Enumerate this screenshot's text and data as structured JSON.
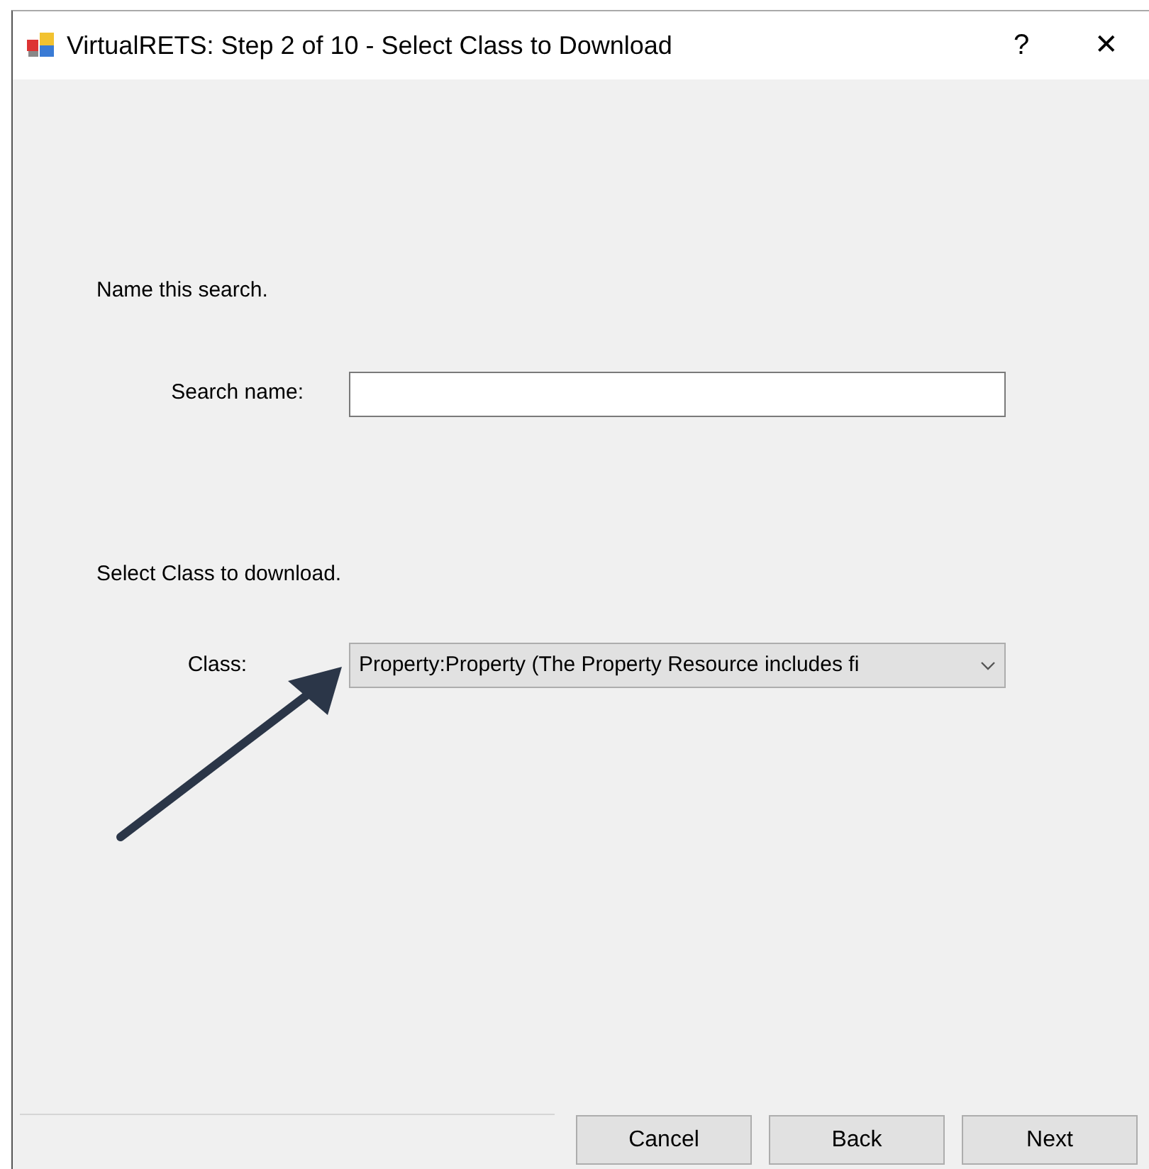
{
  "window": {
    "title": "VirtualRETS: Step 2 of 10 - Select Class to Download",
    "help": "?",
    "close": "✕"
  },
  "name_section": {
    "prompt": "Name this search.",
    "label": "Search name:"
  },
  "class_section": {
    "prompt": "Select Class to download.",
    "label": "Class:",
    "value": "Property:Property (The Property Resource includes fi"
  },
  "buttons": [
    {
      "label": "Cancel"
    },
    {
      "label": "Back"
    },
    {
      "label": "Next"
    }
  ]
}
